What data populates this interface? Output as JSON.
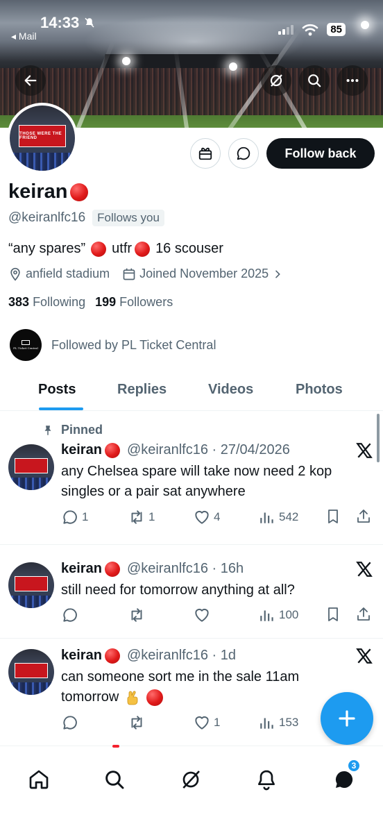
{
  "status_bar": {
    "time": "14:33",
    "back_app": "Mail",
    "battery": "85"
  },
  "profile": {
    "display_name": "keiran",
    "handle": "@keiranlfc16",
    "follows_you": "Follows you",
    "bio_part1": "“any spares”",
    "bio_part2": "utfr",
    "bio_part3": "16 scouser",
    "location": "anfield stadium",
    "joined": "Joined November 2025",
    "following_count": "383",
    "following_label": "Following",
    "followers_count": "199",
    "followers_label": "Followers",
    "followed_by": "Followed by PL Ticket Central",
    "followed_by_logo_text": "PL Ticket Central",
    "follow_back_label": "Follow back",
    "avatar_flag_text": "THOSE WERE THE FRIEND"
  },
  "tabs": [
    {
      "label": "Posts",
      "active": true
    },
    {
      "label": "Replies",
      "active": false
    },
    {
      "label": "Videos",
      "active": false
    },
    {
      "label": "Photos",
      "active": false
    }
  ],
  "pinned_label": "Pinned",
  "posts": [
    {
      "name": "keiran",
      "handle": "@keiranlfc16",
      "time": "· 27/04/2026",
      "text": "any Chelsea spare will take now need 2 kop singles or a pair sat anywhere",
      "replies": "1",
      "reposts": "1",
      "likes": "4",
      "views": "542"
    },
    {
      "name": "keiran",
      "handle": "@keiranlfc16",
      "time": "· 16h",
      "text": "still need for tomorrow anything at all?",
      "replies": "",
      "reposts": "",
      "likes": "",
      "views": "100"
    },
    {
      "name": "keiran",
      "handle": "@keiranlfc16",
      "time": "· 1d",
      "text_line1": "can someone sort me in the sale 11am",
      "text_line2": "tomorrow",
      "replies": "",
      "reposts": "",
      "likes": "1",
      "views": "153"
    }
  ],
  "bottom_nav": {
    "messages_badge": "3"
  },
  "colors": {
    "accent": "#1d9bf0",
    "text_primary": "#0f1419",
    "text_secondary": "#536471",
    "divider": "#eff3f4"
  }
}
